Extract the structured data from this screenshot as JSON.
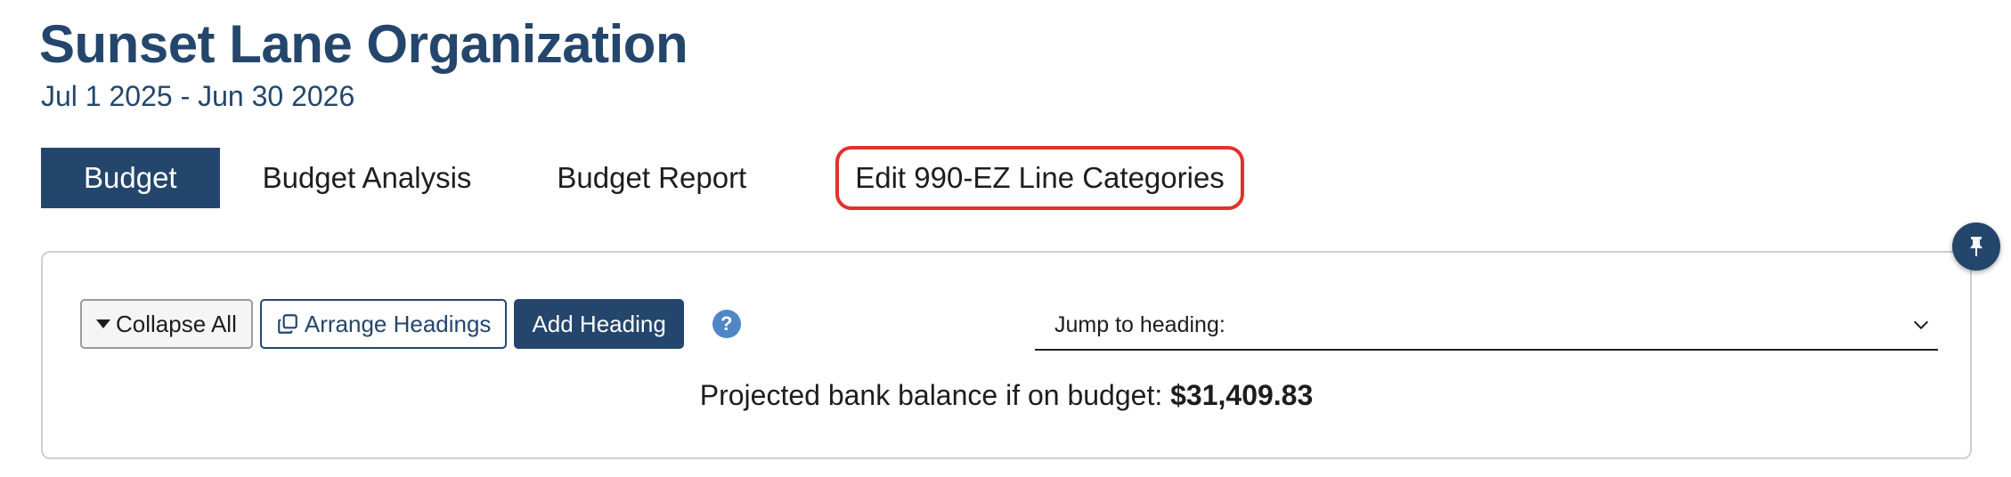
{
  "header": {
    "title": "Sunset Lane Organization",
    "date_range": "Jul 1 2025 - Jun 30 2026"
  },
  "tabs": [
    {
      "label": "Budget",
      "active": true
    },
    {
      "label": "Budget Analysis",
      "active": false
    },
    {
      "label": "Budget Report",
      "active": false
    },
    {
      "label": "Edit 990-EZ Line Categories",
      "active": false,
      "highlighted": true
    }
  ],
  "toolbar": {
    "collapse_label": "Collapse All",
    "arrange_label": "Arrange Headings",
    "add_label": "Add Heading",
    "help_glyph": "?"
  },
  "jump": {
    "label": "Jump to heading:"
  },
  "balance": {
    "label": "Projected bank balance if on budget:",
    "amount": "$31,409.83"
  },
  "icons": {
    "collapse": "caret-down-icon",
    "arrange": "copy-icon",
    "help": "question-circle-icon",
    "jump": "chevron-down-icon",
    "pin": "thumbtack-icon"
  },
  "colors": {
    "primary": "#24466c",
    "highlight": "#e0322c",
    "help": "#4f86c6"
  }
}
